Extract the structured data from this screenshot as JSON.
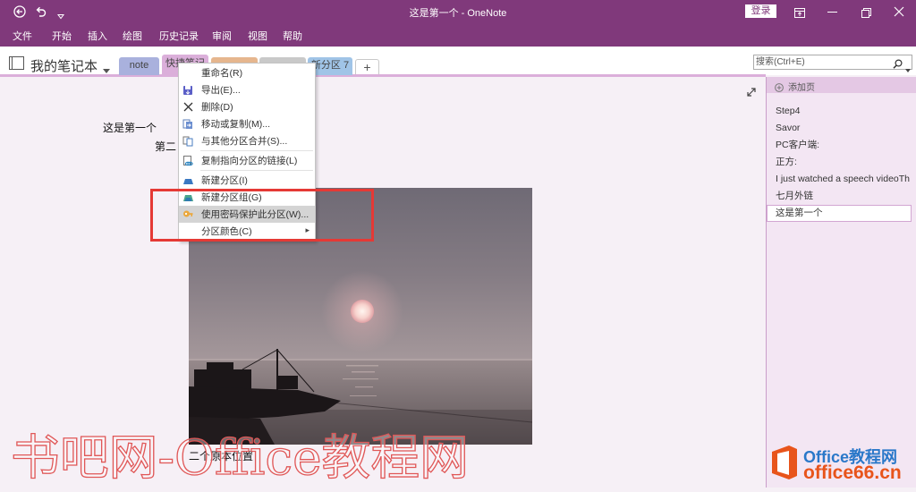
{
  "window": {
    "title": "这是第一个 - OneNote",
    "signin": "登录"
  },
  "menu": [
    "文件",
    "开始",
    "插入",
    "绘图",
    "历史记录",
    "审阅",
    "视图",
    "帮助"
  ],
  "notebook": {
    "name": "我的笔记本"
  },
  "sections": [
    {
      "label": "note",
      "color": "#A9B1DD"
    },
    {
      "label": "快捷笔记",
      "color": "#DBAFDA"
    },
    {
      "label": "",
      "color": "#E6B68E"
    },
    {
      "label": "",
      "color": "#C9C9C9"
    },
    {
      "label": "新分区 7",
      "color": "#A0C4E7"
    }
  ],
  "add_section_label": "+",
  "search": {
    "placeholder": "搜索(Ctrl+E)"
  },
  "context_menu": {
    "items": [
      {
        "label": "重命名(R)",
        "icon": ""
      },
      {
        "label": "导出(E)...",
        "icon": "export-icon"
      },
      {
        "label": "删除(D)",
        "icon": "delete-icon"
      },
      {
        "label": "移动或复制(M)...",
        "icon": "move-copy-icon"
      },
      {
        "label": "与其他分区合并(S)...",
        "icon": "merge-icon"
      },
      {
        "label": "复制指向分区的链接(L)",
        "icon": "link-icon"
      },
      {
        "label": "新建分区(I)",
        "icon": "new-section-icon"
      },
      {
        "label": "新建分区组(G)",
        "icon": "new-section-group-icon"
      },
      {
        "label": "使用密码保护此分区(W)...",
        "icon": "lock-icon",
        "highlighted": true
      },
      {
        "label": "分区颜色(C)",
        "icon": "",
        "submenu": true
      }
    ]
  },
  "page": {
    "lines": [
      "这是第一个",
      "第二"
    ],
    "caption": "二个原本位置"
  },
  "pages_pane": {
    "add_page": "添加页",
    "pages": [
      "Step4",
      "Savor",
      "PC客户端:",
      "正方:",
      "I just watched a speech videoTh",
      "七月外链",
      "这是第一个"
    ],
    "selected_index": 6
  },
  "watermark": "书吧网-Office教程网",
  "logo": {
    "name": "Office教程网",
    "domain": "office66.cn"
  },
  "colors": {
    "title_bar": "#80397B",
    "highlight_box": "#E53935",
    "page_bg": "#F6F0F6",
    "pane_bg": "#F3E6F3"
  }
}
